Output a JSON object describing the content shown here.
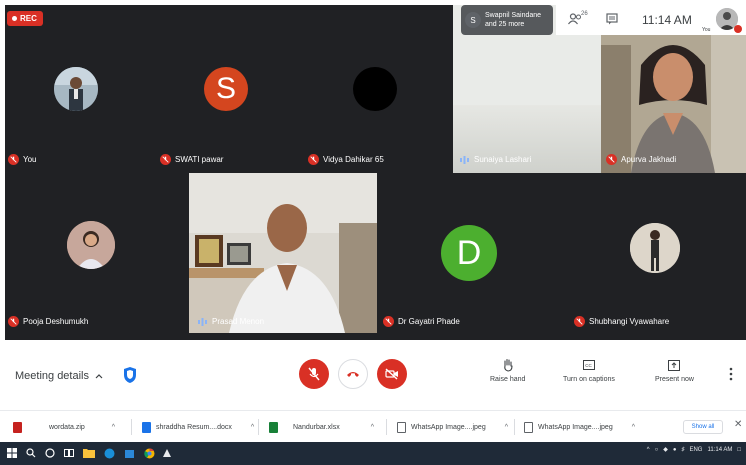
{
  "recording": {
    "label": "REC"
  },
  "top_bar": {
    "participants_avatar_letter": "S",
    "participants_line1": "Swapnil Saindane",
    "participants_line2": "and 25 more",
    "people_count": "26",
    "time": "11:14 AM",
    "self_label": "You"
  },
  "tiles": [
    {
      "name": "You",
      "type": "photo",
      "mic": "off"
    },
    {
      "name": "SWATI pawar",
      "type": "letter",
      "letter": "S",
      "color": "#d4461f",
      "mic": "off"
    },
    {
      "name": "Vidya Dahikar 65",
      "type": "dark",
      "mic": "off"
    },
    {
      "name": "Sunaiya Lashari",
      "type": "video-blank",
      "mic": "speaking"
    },
    {
      "name": "Apurva Jakhadi",
      "type": "video",
      "mic": "off"
    },
    {
      "name": "Pooja Deshumukh",
      "type": "photo",
      "mic": "off"
    },
    {
      "name": "Prasad Menon",
      "type": "video",
      "mic": "speaking"
    },
    {
      "name": "Dr Gayatri Phade",
      "type": "letter",
      "letter": "D",
      "color": "#4caf2f",
      "mic": "off"
    },
    {
      "name": "Shubhangi Vyawahare",
      "type": "photo",
      "mic": "off"
    }
  ],
  "meeting_bar": {
    "meeting_details": "Meeting details",
    "raise_hand": "Raise hand",
    "captions": "Turn on captions",
    "present": "Present now"
  },
  "downloads": {
    "items": [
      {
        "name": "wordata.zip",
        "color": "#c5221f"
      },
      {
        "name": "shraddha Resum....docx",
        "color": "#1a73e8"
      },
      {
        "name": "Nandurbar.xlsx",
        "color": "#188038"
      },
      {
        "name": "WhatsApp Image....jpeg",
        "color": "#5f6368"
      },
      {
        "name": "WhatsApp Image....jpeg",
        "color": "#5f6368"
      }
    ],
    "show_all": "Show all"
  },
  "taskbar": {
    "lang": "ENG",
    "time": "11:14 AM"
  }
}
